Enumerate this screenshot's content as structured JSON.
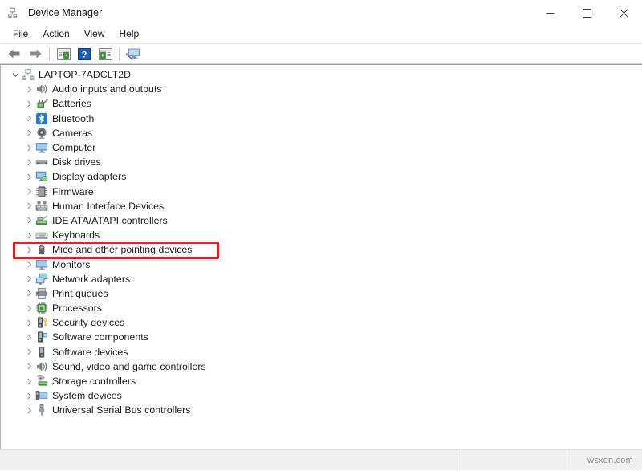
{
  "window": {
    "title": "Device Manager",
    "icon": "device-manager-icon",
    "controls": [
      {
        "name": "minimize-button",
        "glyph": "minimize"
      },
      {
        "name": "maximize-button",
        "glyph": "maximize"
      },
      {
        "name": "close-button",
        "glyph": "close"
      }
    ]
  },
  "menubar": {
    "items": [
      {
        "label": "File"
      },
      {
        "label": "Action"
      },
      {
        "label": "View"
      },
      {
        "label": "Help"
      }
    ]
  },
  "toolbar": {
    "buttons": [
      {
        "name": "back-button",
        "icon": "back-arrow-icon"
      },
      {
        "name": "forward-button",
        "icon": "forward-arrow-icon"
      },
      {
        "name": "separator-1",
        "icon": "separator"
      },
      {
        "name": "show-hide-console-tree-button",
        "icon": "console-tree-icon"
      },
      {
        "name": "help-button",
        "icon": "help-question-icon"
      },
      {
        "name": "properties-button",
        "icon": "properties-icon"
      },
      {
        "name": "separator-2",
        "icon": "separator"
      },
      {
        "name": "scan-hardware-changes-button",
        "icon": "scan-monitor-icon"
      }
    ]
  },
  "tree": {
    "root": {
      "label": "LAPTOP-7ADCLT2D",
      "icon": "computer-node-icon",
      "expanded": true,
      "twisty": "chevron-down"
    },
    "items": [
      {
        "label": "Audio inputs and outputs",
        "icon": "speaker-icon",
        "twisty": "chevron-right"
      },
      {
        "label": "Batteries",
        "icon": "battery-icon",
        "twisty": "chevron-right"
      },
      {
        "label": "Bluetooth",
        "icon": "bluetooth-icon",
        "twisty": "chevron-right"
      },
      {
        "label": "Cameras",
        "icon": "camera-icon",
        "twisty": "chevron-right"
      },
      {
        "label": "Computer",
        "icon": "monitor-icon",
        "twisty": "chevron-right"
      },
      {
        "label": "Disk drives",
        "icon": "disk-drive-icon",
        "twisty": "chevron-right"
      },
      {
        "label": "Display adapters",
        "icon": "display-adapter-icon",
        "twisty": "chevron-right"
      },
      {
        "label": "Firmware",
        "icon": "firmware-chip-icon",
        "twisty": "chevron-right"
      },
      {
        "label": "Human Interface Devices",
        "icon": "hid-icon",
        "twisty": "chevron-right"
      },
      {
        "label": "IDE ATA/ATAPI controllers",
        "icon": "ide-controller-icon",
        "twisty": "chevron-right"
      },
      {
        "label": "Keyboards",
        "icon": "keyboard-icon",
        "twisty": "chevron-right"
      },
      {
        "label": "Mice and other pointing devices",
        "icon": "mouse-icon",
        "twisty": "chevron-right",
        "highlighted": true
      },
      {
        "label": "Monitors",
        "icon": "monitor-icon",
        "twisty": "chevron-right"
      },
      {
        "label": "Network adapters",
        "icon": "network-adapter-icon",
        "twisty": "chevron-right"
      },
      {
        "label": "Print queues",
        "icon": "printer-icon",
        "twisty": "chevron-right"
      },
      {
        "label": "Processors",
        "icon": "processor-icon",
        "twisty": "chevron-right"
      },
      {
        "label": "Security devices",
        "icon": "security-device-icon",
        "twisty": "chevron-right"
      },
      {
        "label": "Software components",
        "icon": "software-component-icon",
        "twisty": "chevron-right"
      },
      {
        "label": "Software devices",
        "icon": "software-device-icon",
        "twisty": "chevron-right"
      },
      {
        "label": "Sound, video and game controllers",
        "icon": "speaker-icon",
        "twisty": "chevron-right"
      },
      {
        "label": "Storage controllers",
        "icon": "storage-controller-icon",
        "twisty": "chevron-right"
      },
      {
        "label": "System devices",
        "icon": "system-device-icon",
        "twisty": "chevron-right"
      },
      {
        "label": "Universal Serial Bus controllers",
        "icon": "usb-icon",
        "twisty": "chevron-right"
      }
    ]
  },
  "annotation": {
    "highlight_color": "#ec1c2b",
    "target_label": "Mice and other pointing devices"
  },
  "statusbar": {
    "pane_1": "",
    "pane_2": "",
    "watermark": "wsxdn.com"
  }
}
